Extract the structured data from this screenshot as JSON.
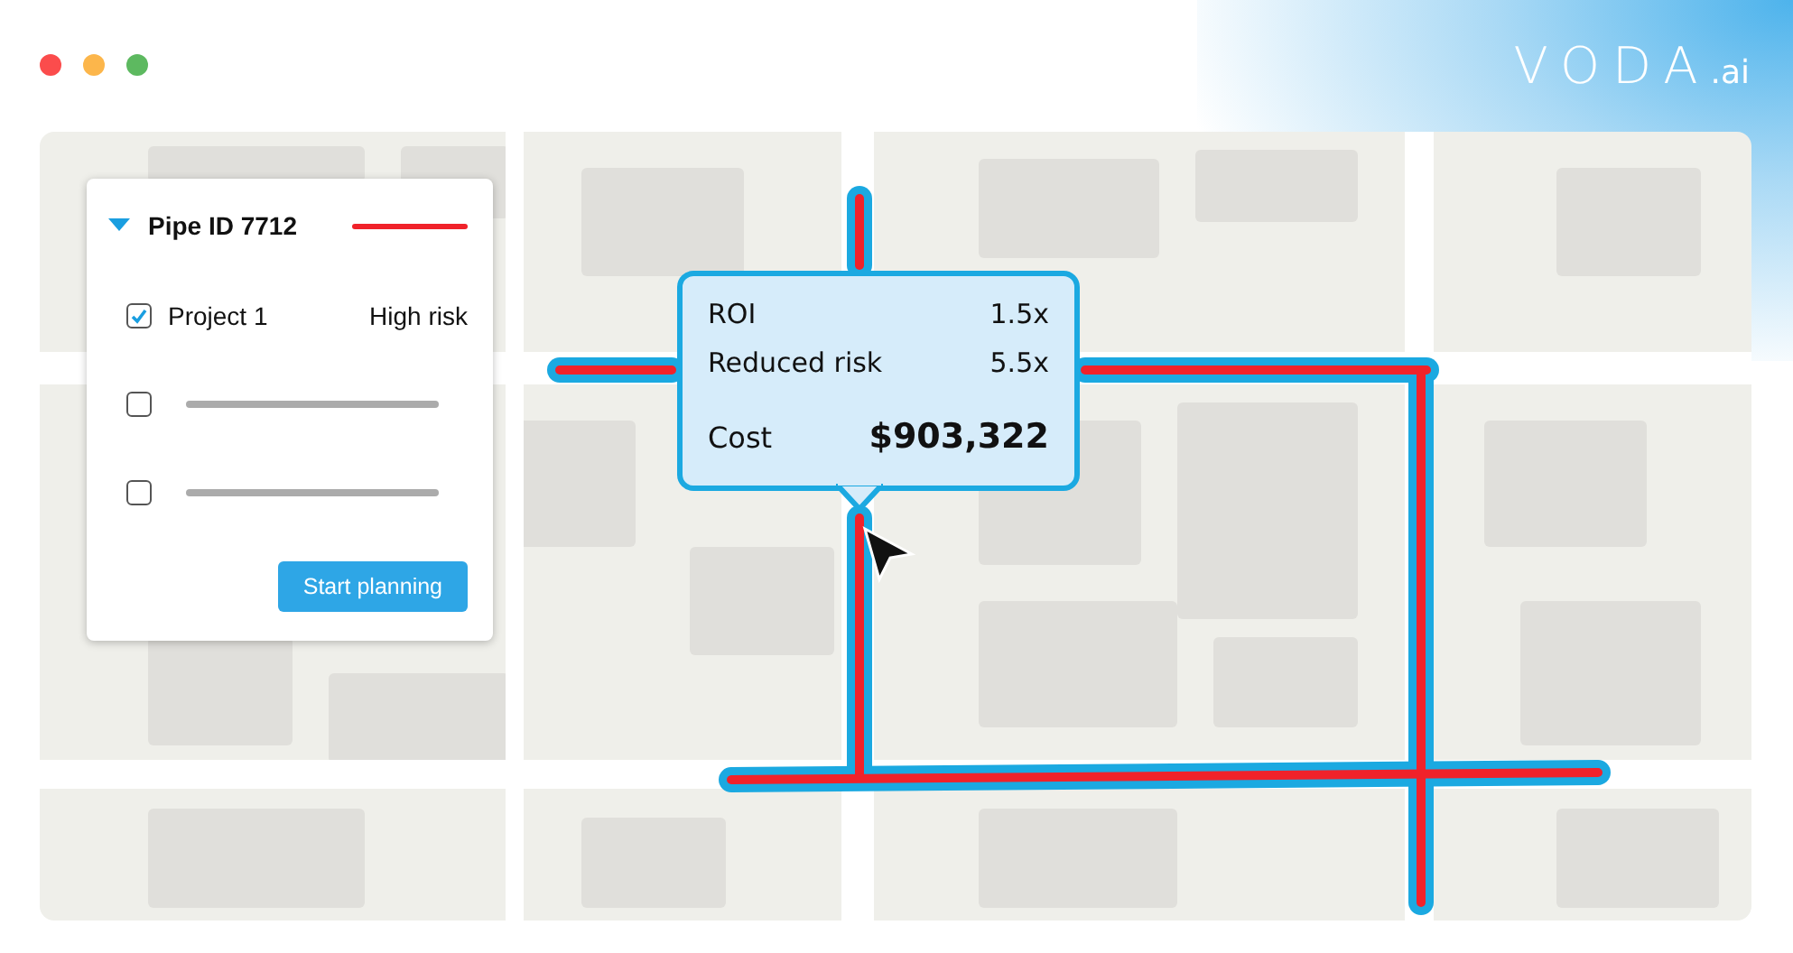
{
  "logo": {
    "name": "VODA",
    "suffix": ".ai"
  },
  "layer_panel": {
    "title": "Pipe ID 7712",
    "expanded": true,
    "projects": [
      {
        "kind": "text",
        "label": "Project 1",
        "risk": "High risk",
        "checked": true
      },
      {
        "kind": "placeholder",
        "checked": false
      },
      {
        "kind": "placeholder",
        "checked": false
      }
    ],
    "button": "Start planning"
  },
  "tooltip": {
    "rows": [
      {
        "kind": "metric",
        "label": "ROI",
        "value": "1.5x"
      },
      {
        "kind": "metric",
        "label": "Reduced risk",
        "value": "5.5x"
      },
      {
        "kind": "total",
        "label": "Cost",
        "value": "$903,322"
      }
    ]
  }
}
